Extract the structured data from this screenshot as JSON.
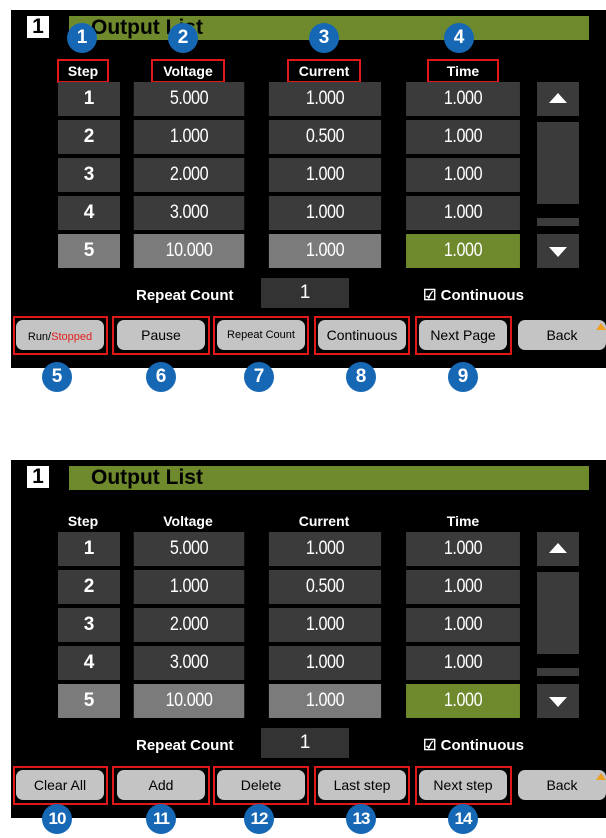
{
  "screens": [
    {
      "channel": "1",
      "title": "Output List",
      "headers": {
        "step": "Step",
        "voltage": "Voltage",
        "current": "Current",
        "time": "Time"
      },
      "rows": [
        {
          "step": "1",
          "voltage": "5.000",
          "current": "1.000",
          "time": "1.000"
        },
        {
          "step": "2",
          "voltage": "1.000",
          "current": "0.500",
          "time": "1.000"
        },
        {
          "step": "3",
          "voltage": "2.000",
          "current": "1.000",
          "time": "1.000"
        },
        {
          "step": "4",
          "voltage": "3.000",
          "current": "1.000",
          "time": "1.000"
        },
        {
          "step": "5",
          "voltage": "10.000",
          "current": "1.000",
          "time": "1.000"
        }
      ],
      "repeat_label": "Repeat Count",
      "repeat_value": "1",
      "continuous_label": "☑ Continuous",
      "softkeys": {
        "k1_prefix": "Run/",
        "k1_red": "Stopped",
        "k2": "Pause",
        "k3": "Repeat Count",
        "k4": "Continuous",
        "k5": "Next Page",
        "back": "Back"
      }
    },
    {
      "channel": "1",
      "title": "Output List",
      "headers": {
        "step": "Step",
        "voltage": "Voltage",
        "current": "Current",
        "time": "Time"
      },
      "rows": [
        {
          "step": "1",
          "voltage": "5.000",
          "current": "1.000",
          "time": "1.000"
        },
        {
          "step": "2",
          "voltage": "1.000",
          "current": "0.500",
          "time": "1.000"
        },
        {
          "step": "3",
          "voltage": "2.000",
          "current": "1.000",
          "time": "1.000"
        },
        {
          "step": "4",
          "voltage": "3.000",
          "current": "1.000",
          "time": "1.000"
        },
        {
          "step": "5",
          "voltage": "10.000",
          "current": "1.000",
          "time": "1.000"
        }
      ],
      "repeat_label": "Repeat Count",
      "repeat_value": "1",
      "continuous_label": "☑ Continuous",
      "softkeys": {
        "k1": "Clear All",
        "k2": "Add",
        "k3": "Delete",
        "k4": "Last step",
        "k5": "Next step",
        "back": "Back"
      }
    }
  ],
  "callouts": [
    "1",
    "2",
    "3",
    "4",
    "5",
    "6",
    "7",
    "8",
    "9",
    "10",
    "11",
    "12",
    "13",
    "14"
  ],
  "colors": {
    "callout": "#1668b5",
    "highlight": "#e01818",
    "title_bar": "#6f8a2c",
    "stopped_text": "#e41e1e"
  },
  "icons": [
    "scroll-up-arrow-icon",
    "scroll-down-arrow-icon",
    "checkbox-checked-icon"
  ]
}
